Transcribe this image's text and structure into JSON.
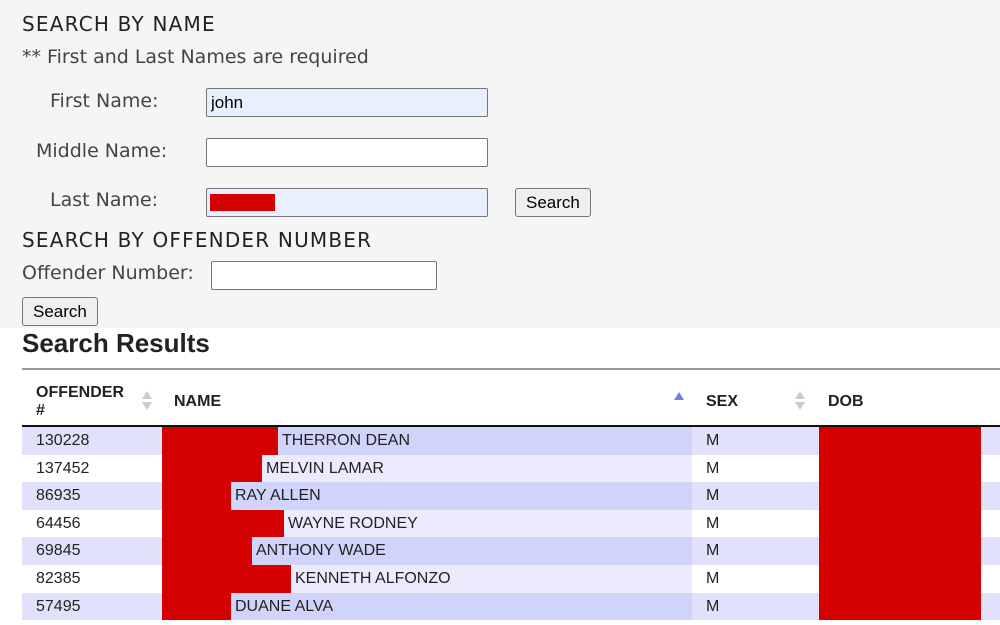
{
  "search_by_name": {
    "heading": "SEARCH BY NAME",
    "note": "** First and Last Names are required",
    "first_name": {
      "label": "First Name:",
      "value": "john"
    },
    "middle_name": {
      "label": "Middle Name:",
      "value": ""
    },
    "last_name": {
      "label": "Last Name:",
      "value": "[redacted]"
    },
    "search_button": "Search"
  },
  "search_by_number": {
    "heading": "SEARCH BY OFFENDER NUMBER",
    "offender_number": {
      "label": "Offender Number:",
      "value": ""
    },
    "search_button": "Search"
  },
  "results": {
    "title": "Search Results",
    "columns": [
      {
        "label": "OFFENDER #",
        "sort": "none"
      },
      {
        "label": "NAME",
        "sort": "ascending"
      },
      {
        "label": "SEX",
        "sort": "none"
      },
      {
        "label": "DOB",
        "sort": "none"
      }
    ],
    "colors": {
      "redaction": "#d40000",
      "row_odd": "#e1e1fc",
      "sorted_col_odd": "#d0d3fa",
      "sort_active": "#7780d8"
    },
    "rows": [
      {
        "offender_no": "130228",
        "name": "THERRON DEAN",
        "sex": "M",
        "dob": "[redacted]"
      },
      {
        "offender_no": "137452",
        "name": "MELVIN LAMAR",
        "sex": "M",
        "dob": "[redacted]"
      },
      {
        "offender_no": "86935",
        "name": "RAY ALLEN",
        "sex": "M",
        "dob": "[redacted]"
      },
      {
        "offender_no": "64456",
        "name": "WAYNE RODNEY",
        "sex": "M",
        "dob": "[redacted]"
      },
      {
        "offender_no": "69845",
        "name": "ANTHONY WADE",
        "sex": "M",
        "dob": "[redacted]"
      },
      {
        "offender_no": "82385",
        "name": "KENNETH ALFONZO",
        "sex": "M",
        "dob": "[redacted]"
      },
      {
        "offender_no": "57495",
        "name": "DUANE ALVA",
        "sex": "M",
        "dob": "[redacted]"
      }
    ]
  }
}
